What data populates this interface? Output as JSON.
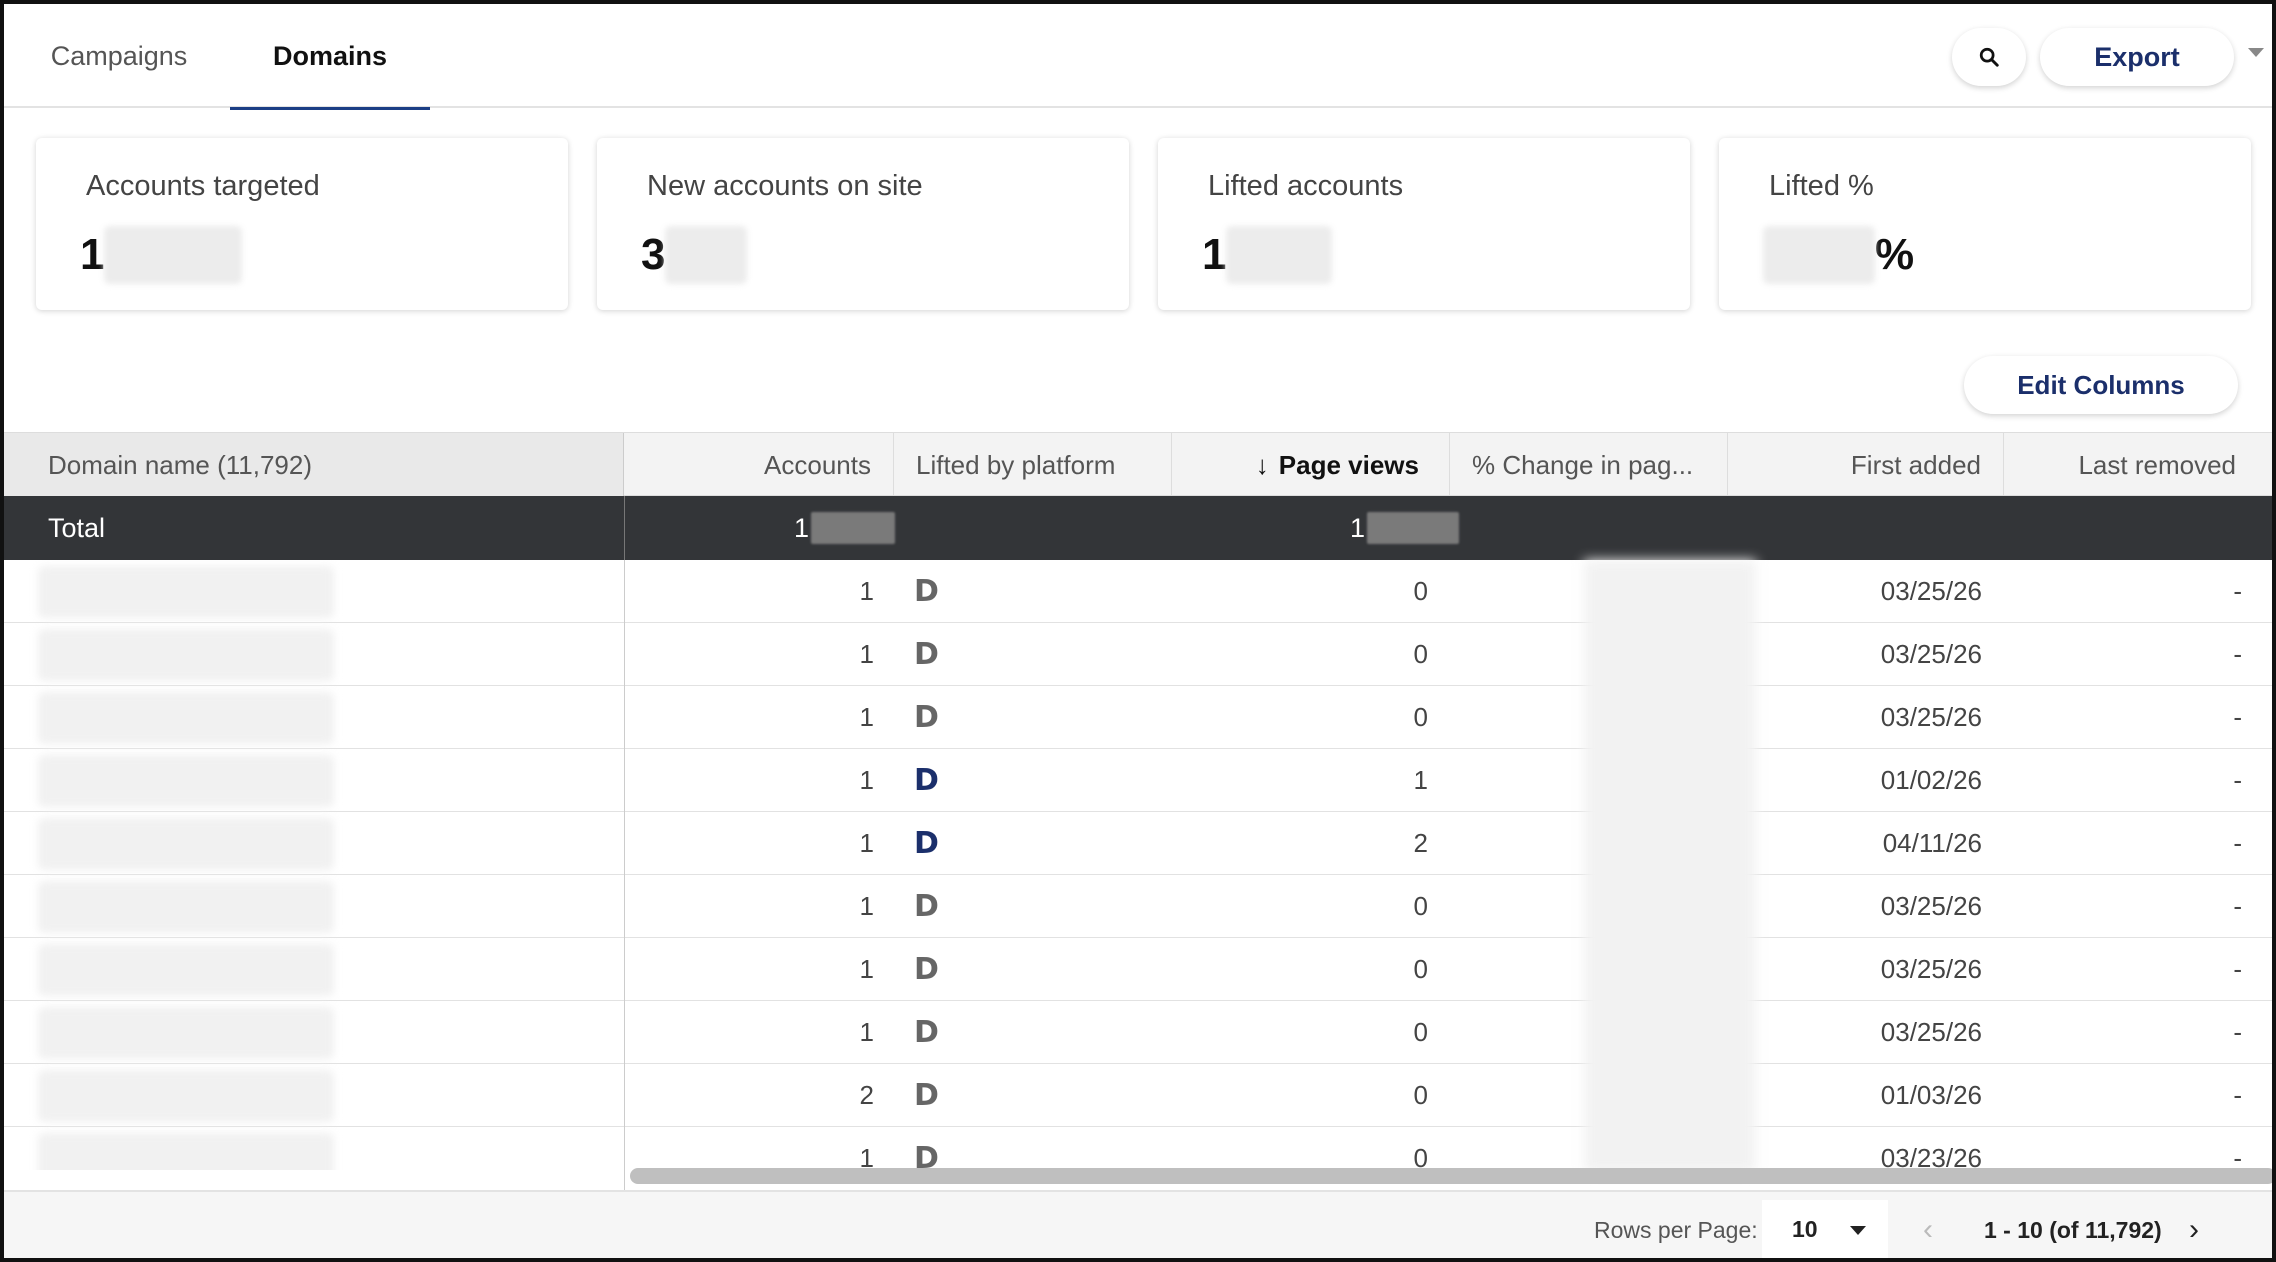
{
  "tabs": [
    {
      "label": "Campaigns"
    },
    {
      "label": "Domains"
    }
  ],
  "toolbar": {
    "export_label": "Export"
  },
  "cards": [
    {
      "label": "Accounts targeted",
      "value_prefix": "1",
      "value_suffix": ""
    },
    {
      "label": "New accounts on site",
      "value_prefix": "3",
      "value_suffix": ""
    },
    {
      "label": "Lifted accounts",
      "value_prefix": "1",
      "value_suffix": ""
    },
    {
      "label": "Lifted %",
      "value_prefix": "",
      "value_suffix": "%"
    }
  ],
  "edit_columns_label": "Edit Columns",
  "table": {
    "columns": [
      "Domain name (11,792)",
      "Accounts",
      "Lifted by platform",
      "Page views",
      "% Change in pag...",
      "First added",
      "Last removed"
    ],
    "sort_arrow": "↓",
    "total": {
      "label": "Total",
      "accounts_prefix": "1",
      "page_views_prefix": "1"
    },
    "rows": [
      {
        "accounts": "1",
        "lifted_icon": "D",
        "lifted_color": "gray",
        "page_views": "0",
        "first_added": "03/25/26",
        "last_removed": "-"
      },
      {
        "accounts": "1",
        "lifted_icon": "D",
        "lifted_color": "gray",
        "page_views": "0",
        "first_added": "03/25/26",
        "last_removed": "-"
      },
      {
        "accounts": "1",
        "lifted_icon": "D",
        "lifted_color": "gray",
        "page_views": "0",
        "first_added": "03/25/26",
        "last_removed": "-"
      },
      {
        "accounts": "1",
        "lifted_icon": "D",
        "lifted_color": "blue",
        "page_views": "1",
        "first_added": "01/02/26",
        "last_removed": "-"
      },
      {
        "accounts": "1",
        "lifted_icon": "D",
        "lifted_color": "blue",
        "page_views": "2",
        "first_added": "04/11/26",
        "last_removed": "-"
      },
      {
        "accounts": "1",
        "lifted_icon": "D",
        "lifted_color": "gray",
        "page_views": "0",
        "first_added": "03/25/26",
        "last_removed": "-"
      },
      {
        "accounts": "1",
        "lifted_icon": "D",
        "lifted_color": "gray",
        "page_views": "0",
        "first_added": "03/25/26",
        "last_removed": "-"
      },
      {
        "accounts": "1",
        "lifted_icon": "D",
        "lifted_color": "gray",
        "page_views": "0",
        "first_added": "03/25/26",
        "last_removed": "-"
      },
      {
        "accounts": "2",
        "lifted_icon": "D",
        "lifted_color": "gray",
        "page_views": "0",
        "first_added": "01/03/26",
        "last_removed": "-"
      },
      {
        "accounts": "1",
        "lifted_icon": "D",
        "lifted_color": "gray",
        "page_views": "0",
        "first_added": "03/23/26",
        "last_removed": "-"
      }
    ]
  },
  "pagination": {
    "rows_per_page_label": "Rows per Page:",
    "rows_per_page_value": "10",
    "range": "1 - 10 (of 11,792)",
    "prev": "‹",
    "next": "›"
  },
  "colors": {
    "accent": "#1b3e85",
    "brand_text": "#1b2f6b",
    "total_bg": "#333538"
  }
}
